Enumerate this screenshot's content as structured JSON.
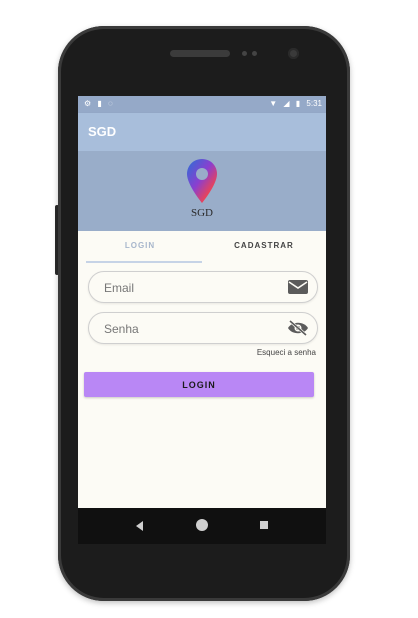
{
  "status_bar": {
    "time": "5:31",
    "left_icons": [
      "gear-icon",
      "sd-card-icon",
      "circle-icon"
    ],
    "right_icons": [
      "wifi-icon",
      "signal-icon",
      "battery-icon"
    ]
  },
  "app_bar": {
    "title": "SGD"
  },
  "header": {
    "logo_text": "SGD",
    "logo_icon": "location-pin-icon"
  },
  "tabs": [
    {
      "label": "LOGIN",
      "active": true
    },
    {
      "label": "CADASTRAR",
      "active": false
    }
  ],
  "form": {
    "email": {
      "placeholder": "Email",
      "value": "",
      "icon": "mail-icon"
    },
    "password": {
      "placeholder": "Senha",
      "value": "",
      "icon": "eye-off-icon"
    },
    "forgot_label": "Esqueci a senha",
    "submit_label": "LOGIN"
  },
  "nav": {
    "icons": [
      "back-icon",
      "home-icon",
      "recent-apps-icon"
    ]
  },
  "colors": {
    "status_bar": "#95a9c8",
    "app_bar": "#a8bedb",
    "header_band": "#99adc9",
    "login_button": "#b987f5",
    "screen_background": "#fcfbf5"
  }
}
